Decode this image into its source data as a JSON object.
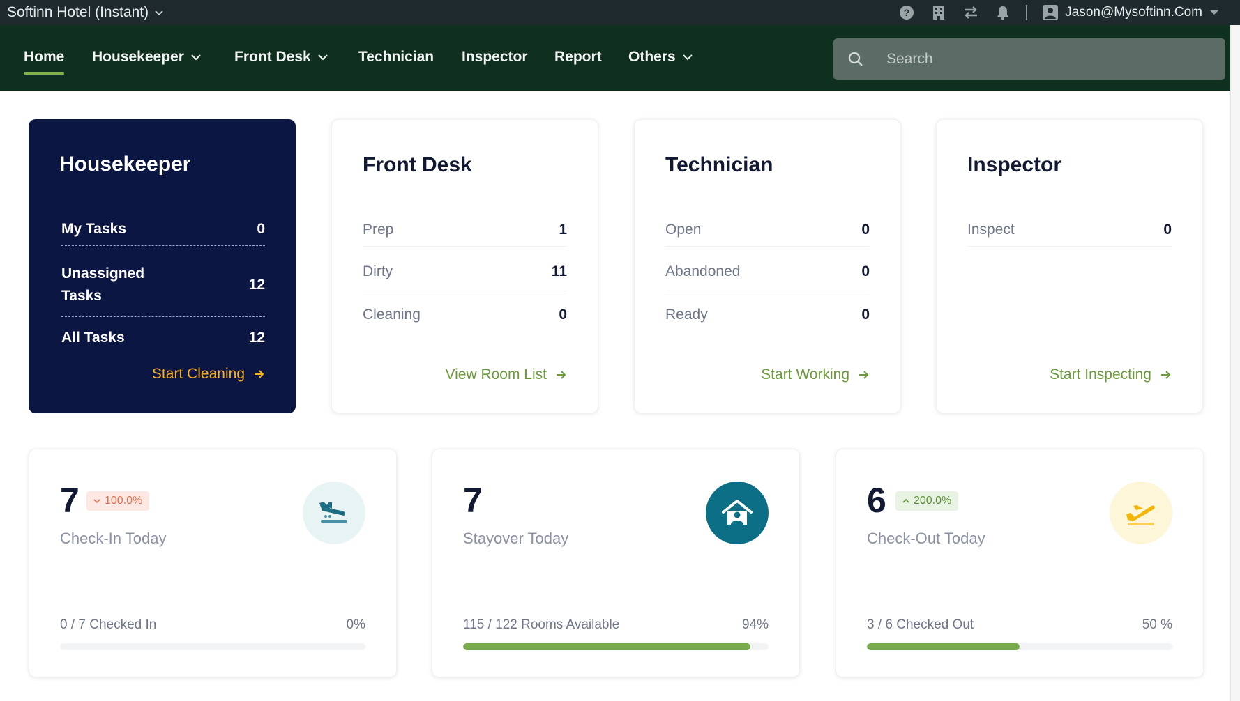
{
  "topbar": {
    "hotel_name": "Softinn Hotel (Instant)",
    "icons": [
      "help-icon",
      "building-icon",
      "switch-icon",
      "bell-icon"
    ],
    "user_email": "Jason@Mysoftinn.Com"
  },
  "nav": {
    "items": [
      {
        "label": "Home",
        "active": true,
        "dropdown": false
      },
      {
        "label": "Housekeeper",
        "dropdown": true
      },
      {
        "label": "Front Desk",
        "dropdown": true
      },
      {
        "label": "Technician",
        "dropdown": false
      },
      {
        "label": "Inspector",
        "dropdown": false
      },
      {
        "label": "Report",
        "dropdown": false
      },
      {
        "label": "Others",
        "dropdown": true
      }
    ],
    "search_placeholder": "Search"
  },
  "roles": {
    "housekeeper": {
      "title": "Housekeeper",
      "rows": [
        {
          "label": "My Tasks",
          "value": "0"
        },
        {
          "label": "Unassigned",
          "label2": "Tasks",
          "value": "12"
        },
        {
          "label": "All Tasks",
          "value": "12"
        }
      ],
      "link": "Start Cleaning"
    },
    "frontdesk": {
      "title": "Front Desk",
      "rows": [
        {
          "label": "Prep",
          "value": "1"
        },
        {
          "label": "Dirty",
          "value": "11"
        },
        {
          "label": "Cleaning",
          "value": "0"
        }
      ],
      "link": "View Room List"
    },
    "technician": {
      "title": "Technician",
      "rows": [
        {
          "label": "Open",
          "value": "0"
        },
        {
          "label": "Abandoned",
          "value": "0"
        },
        {
          "label": "Ready",
          "value": "0"
        }
      ],
      "link": "Start Working"
    },
    "inspector": {
      "title": "Inspector",
      "rows": [
        {
          "label": "Inspect",
          "value": "0"
        }
      ],
      "link": "Start Inspecting"
    }
  },
  "stats": {
    "checkin": {
      "number": "7",
      "badge": "100.0%",
      "badge_dir": "down",
      "label": "Check-In Today",
      "foot_left": "0 / 7 Checked In",
      "foot_right": "0%",
      "progress": 0,
      "icon": "plane-landing-icon"
    },
    "stayover": {
      "number": "7",
      "label": "Stayover Today",
      "foot_left": "115 / 122 Rooms Available",
      "foot_right": "94%",
      "progress": 0.94,
      "icon": "house-person-icon"
    },
    "checkout": {
      "number": "6",
      "badge": "200.0%",
      "badge_dir": "up",
      "label": "Check-Out Today",
      "foot_left": "3 / 6 Checked Out",
      "foot_right": "50 %",
      "progress": 0.5,
      "icon": "plane-takeoff-icon"
    }
  },
  "colors": {
    "topbar_bg": "#1e2a2e",
    "nav_bg": "#10301f",
    "accent_green": "#7aab4a",
    "housekeeper_bg": "#0c1643",
    "housekeeper_link": "#f5b21b",
    "stayover_icon_bg": "#0d6f86"
  }
}
